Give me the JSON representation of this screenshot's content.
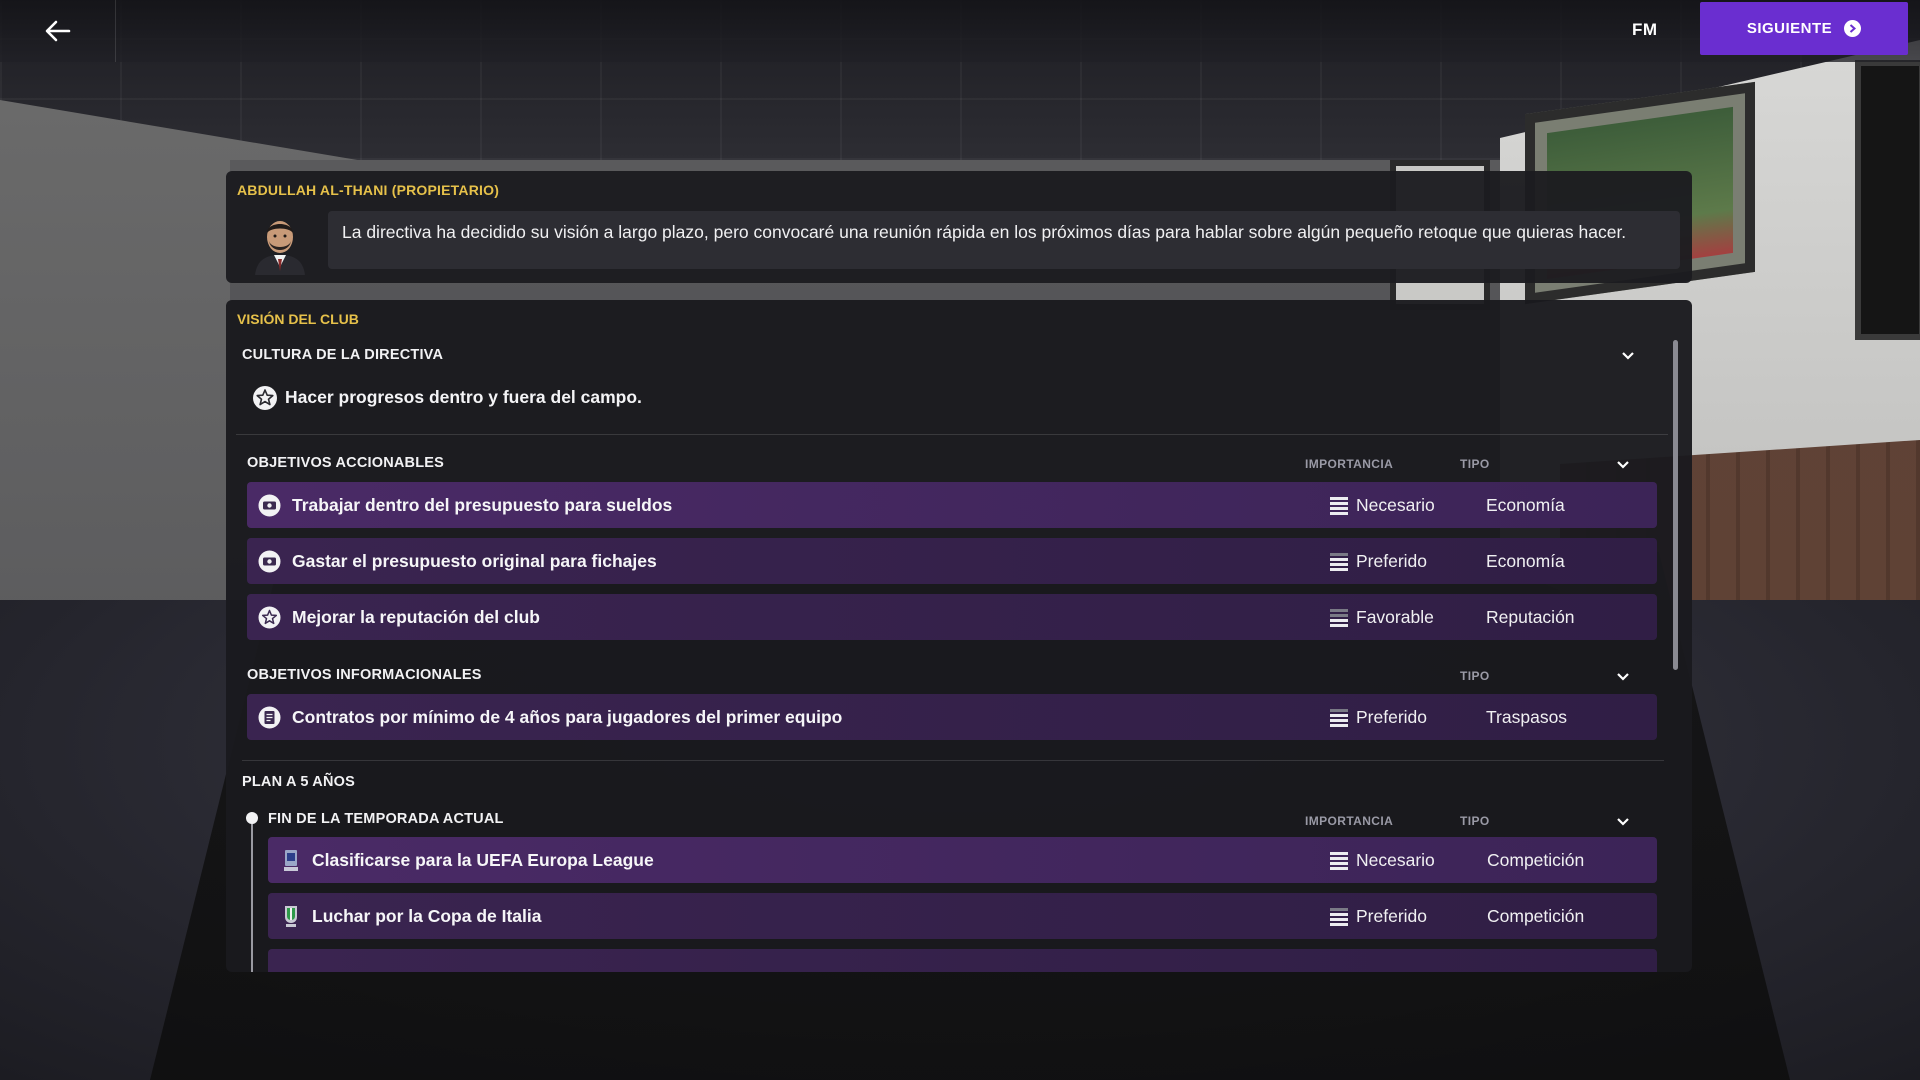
{
  "topbar": {
    "logo": "FM",
    "next_label": "SIGUIENTE"
  },
  "owner": {
    "name": "ABDULLAH AL-THANI (PROPIETARIO)",
    "message": "La directiva ha decidido su visión a largo plazo, pero convocaré una reunión rápida en los próximos días para hablar sobre algún pequeño retoque que quieras hacer."
  },
  "vision": {
    "title": "VISIÓN DEL CLUB",
    "culture": {
      "heading": "CULTURA DE LA DIRECTIVA",
      "item": "Hacer progresos dentro y fuera del campo."
    },
    "actionable": {
      "heading": "OBJETIVOS ACCIONABLES",
      "col_importance": "IMPORTANCIA",
      "col_type": "TIPO",
      "rows": [
        {
          "label": "Trabajar dentro del presupuesto para sueldos",
          "importance": "Necesario",
          "level": 4,
          "type": "Economía",
          "icon": "money-icon"
        },
        {
          "label": "Gastar el presupuesto original para fichajes",
          "importance": "Preferido",
          "level": 3,
          "type": "Economía",
          "icon": "money-icon"
        },
        {
          "label": "Mejorar la reputación del club",
          "importance": "Favorable",
          "level": 2,
          "type": "Reputación",
          "icon": "star-icon"
        }
      ]
    },
    "informational": {
      "heading": "OBJETIVOS INFORMACIONALES",
      "col_type": "TIPO",
      "rows": [
        {
          "label": "Contratos por mínimo de 4 años para jugadores del primer equipo",
          "importance": "Preferido",
          "level": 3,
          "type": "Traspasos",
          "icon": "contract-icon"
        }
      ]
    },
    "plan": {
      "heading": "PLAN A 5 AÑOS",
      "stage": "FIN DE LA TEMPORADA ACTUAL",
      "col_importance": "IMPORTANCIA",
      "col_type": "TIPO",
      "rows": [
        {
          "label": "Clasificarse para la UEFA Europa League",
          "importance": "Necesario",
          "level": 4,
          "type": "Competición",
          "icon": "europa-league-icon"
        },
        {
          "label": "Luchar por la Copa de Italia",
          "importance": "Preferido",
          "level": 3,
          "type": "Competición",
          "icon": "coppa-italia-icon"
        }
      ]
    }
  },
  "colors": {
    "accent_purple": "#6a2ed0",
    "section_gold": "#e6c14a",
    "row_purple": "#4a2a66"
  }
}
